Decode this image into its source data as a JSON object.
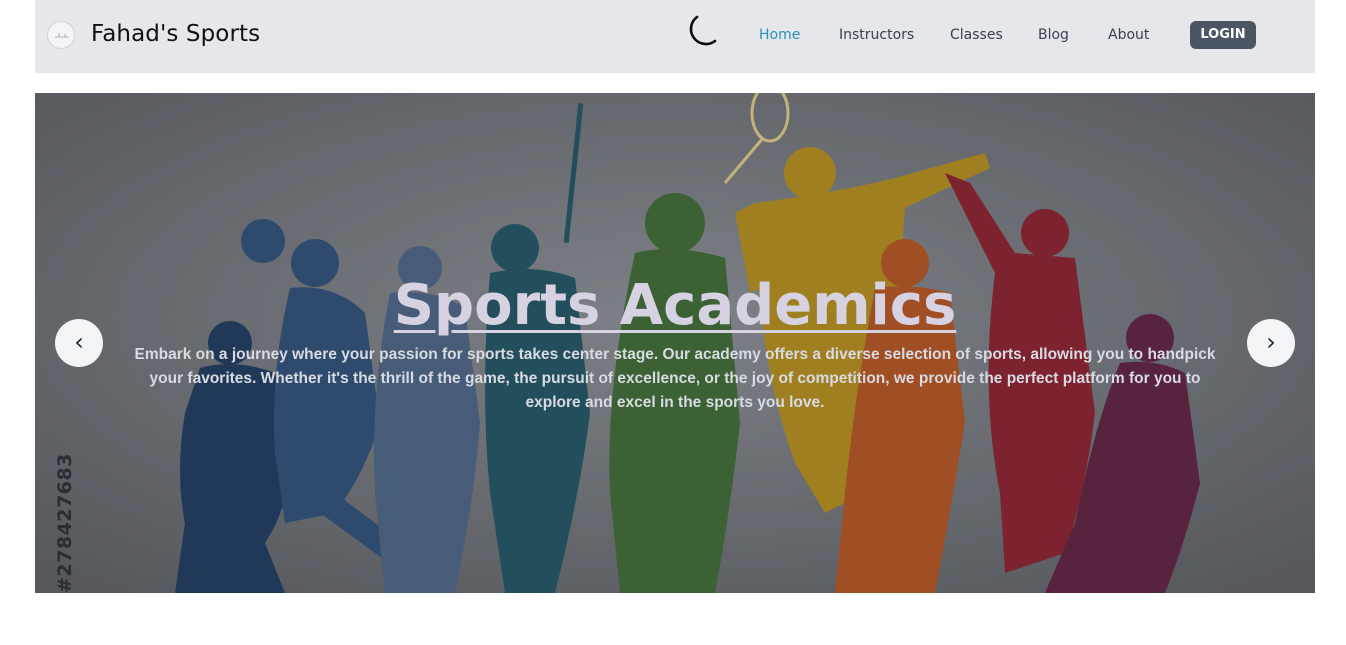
{
  "header": {
    "brand": "Fahad's Sports",
    "nav": [
      {
        "label": "Home",
        "active": true
      },
      {
        "label": "Instructors",
        "active": false
      },
      {
        "label": "Classes",
        "active": false
      },
      {
        "label": "Blog",
        "active": false
      },
      {
        "label": "About",
        "active": false
      }
    ],
    "login_label": "LOGIN",
    "theme_toggle_icon": "moon-icon"
  },
  "hero": {
    "title": "Sports Academics",
    "description": "Embark on a journey where your passion for sports takes center stage. Our academy offers a diverse selection of sports, allowing you to handpick your favorites. Whether it's the thrill of the game, the pursuit of excellence, or the joy of competition, we provide the perfect platform for you to explore and excel in the sports you love.",
    "stock_id": "#278427683",
    "prev_icon": "‹",
    "next_icon": "›"
  },
  "colors": {
    "navbar_bg": "#e5e7eb",
    "active_link": "#2b8fb3",
    "login_bg": "#4b5563"
  }
}
